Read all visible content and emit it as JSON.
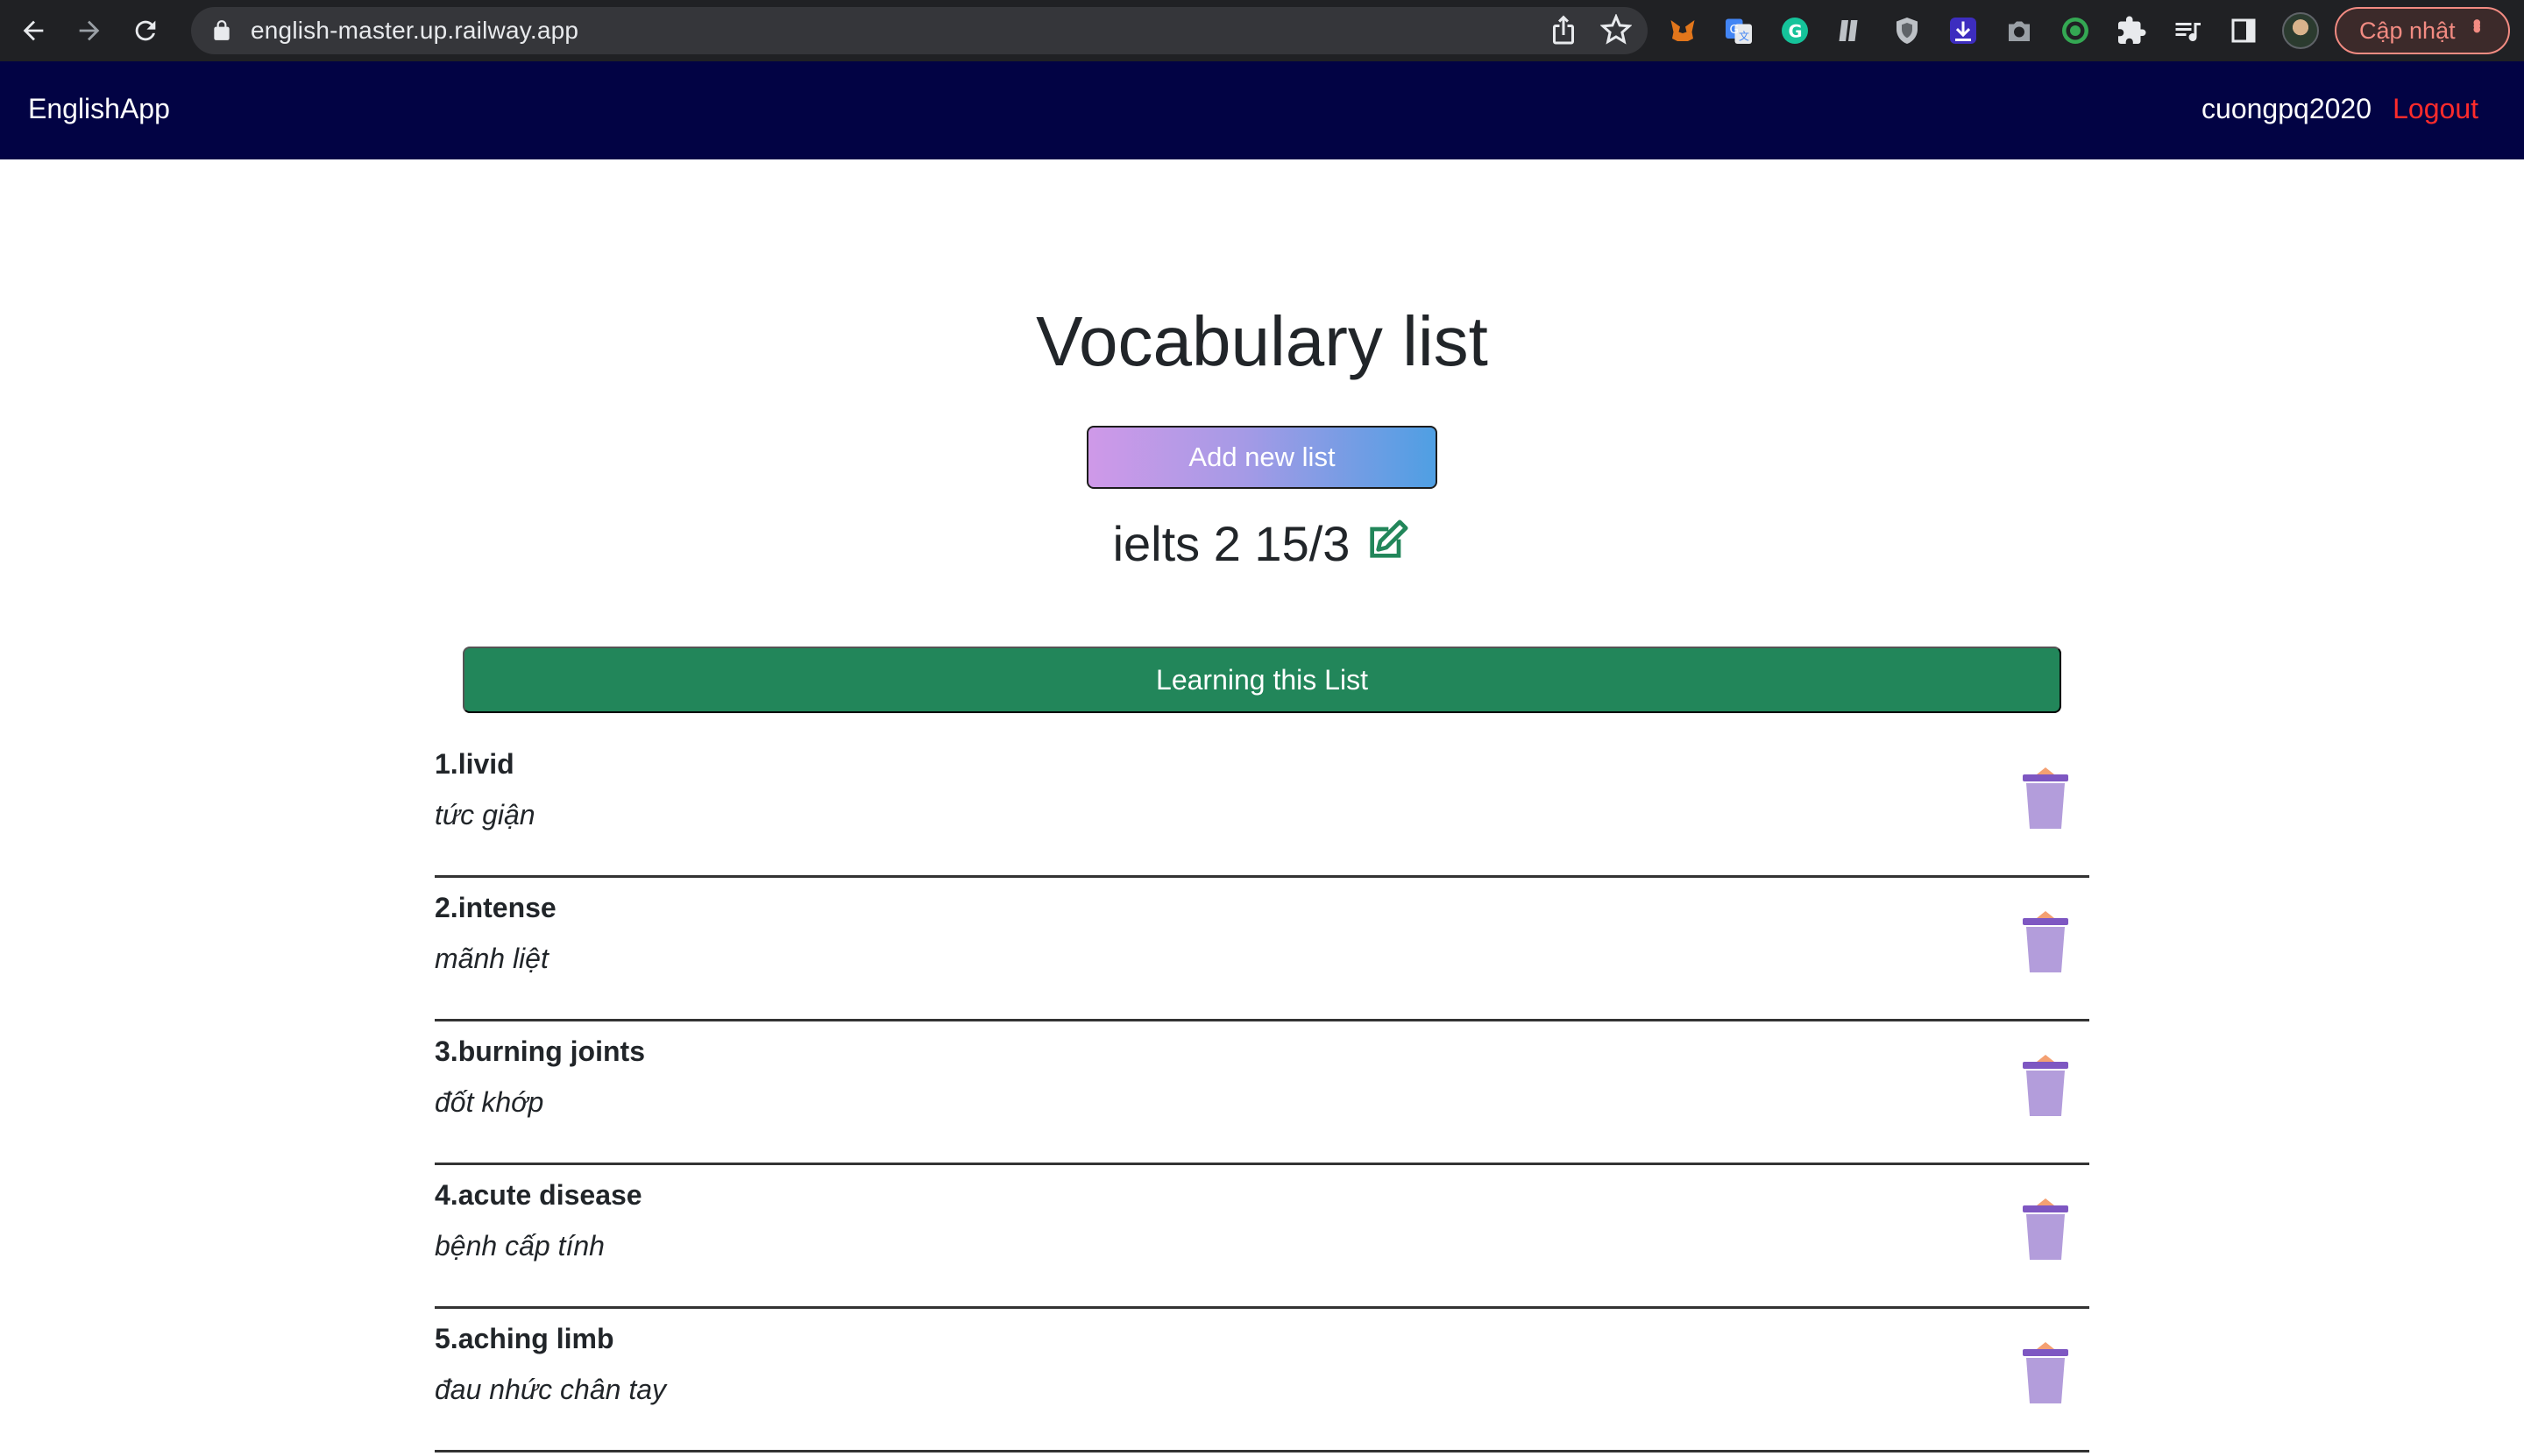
{
  "browser": {
    "url": "english-master.up.railway.app",
    "update_label": "Cập nhật",
    "extensions": [
      "metamask-icon",
      "google-translate-icon",
      "grammarly-icon",
      "notes-icon",
      "shield-icon",
      "download-icon",
      "camera-icon",
      "circle-target-icon",
      "puzzle-icon",
      "media-icon",
      "sidepanel-icon"
    ]
  },
  "navbar": {
    "brand": "EnglishApp",
    "username": "cuongpq2020",
    "logout": "Logout"
  },
  "main": {
    "title": "Vocabulary list",
    "add_list_label": "Add new list",
    "list_name": "ielts 2 15/3",
    "learn_label": "Learning this List",
    "words": [
      {
        "word": "1.livid",
        "meaning": "tức giận"
      },
      {
        "word": "2.intense",
        "meaning": "mãnh liệt"
      },
      {
        "word": "3.burning joints",
        "meaning": "đốt khớp"
      },
      {
        "word": "4.acute disease",
        "meaning": "bệnh cấp tính"
      },
      {
        "word": "5.aching limb",
        "meaning": "đau nhức chân tay"
      }
    ]
  },
  "colors": {
    "navbar_bg": "#020344",
    "logout": "#ff2b2b",
    "learn_btn": "#22865a",
    "edit_icon": "#22865a",
    "trash_body": "#b39ddb",
    "trash_lid": "#7e57c2",
    "trash_top": "#f4a072"
  }
}
